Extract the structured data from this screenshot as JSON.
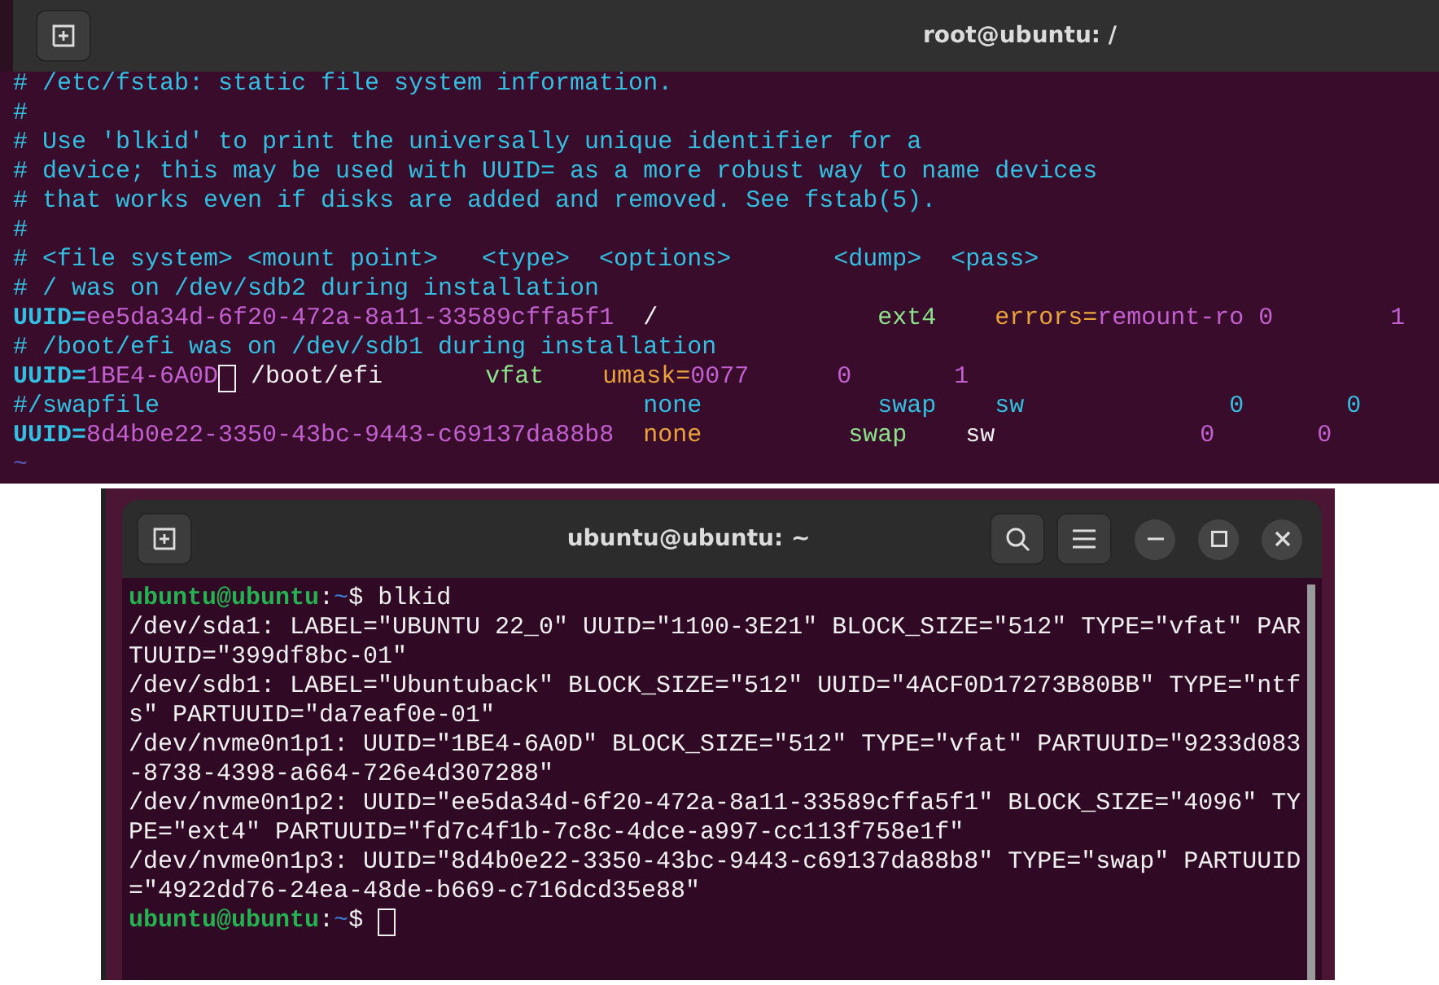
{
  "editor_window": {
    "title": "root@ubuntu: /",
    "lines": [
      [
        {
          "kind": "comment",
          "text": "# /etc/fstab: static file system information."
        }
      ],
      [
        {
          "kind": "comment",
          "text": "#"
        }
      ],
      [
        {
          "kind": "comment",
          "text": "# Use 'blkid' to print the universally unique identifier for a"
        }
      ],
      [
        {
          "kind": "comment",
          "text": "# device; this may be used with UUID= as a more robust way to name devices"
        }
      ],
      [
        {
          "kind": "comment",
          "text": "# that works even if disks are added and removed. See fstab(5)."
        }
      ],
      [
        {
          "kind": "comment",
          "text": "#"
        }
      ],
      [
        {
          "kind": "comment",
          "text": "# <file system> <mount point>   <type>  <options>       <dump>  <pass>"
        }
      ],
      [
        {
          "kind": "comment",
          "text": "# / was on /dev/sdb2 during installation"
        }
      ],
      [
        {
          "kind": "key",
          "text": "UUID="
        },
        {
          "kind": "value",
          "text": "ee5da34d-6f20-472a-8a11-33589cffa5f1"
        },
        {
          "kind": "plain",
          "text": "  /               "
        },
        {
          "kind": "type",
          "text": "ext4    "
        },
        {
          "kind": "option",
          "text": "errors="
        },
        {
          "kind": "value",
          "text": "remount-ro 0        1"
        }
      ],
      [
        {
          "kind": "comment",
          "text": "# /boot/efi was on /dev/sdb1 during installation"
        }
      ],
      [
        {
          "kind": "key",
          "text": "UUID="
        },
        {
          "kind": "value",
          "text": "1BE4-6A0D"
        },
        {
          "kind": "cursor"
        },
        {
          "kind": "plain",
          "text": " /boot/efi       "
        },
        {
          "kind": "type",
          "text": "vfat    "
        },
        {
          "kind": "option",
          "text": "umask="
        },
        {
          "kind": "value",
          "text": "0077      0       1"
        }
      ],
      [
        {
          "kind": "comment",
          "text": "#/swapfile                                 none            swap    sw              0       0"
        }
      ],
      [
        {
          "kind": "key",
          "text": "UUID="
        },
        {
          "kind": "value",
          "text": "8d4b0e22-3350-43bc-9443-c69137da88b8  "
        },
        {
          "kind": "option",
          "text": "none          "
        },
        {
          "kind": "type",
          "text": "swap"
        },
        {
          "kind": "plain",
          "text": "    sw              "
        },
        {
          "kind": "value",
          "text": "0       0"
        }
      ]
    ],
    "end_marker": "~"
  },
  "terminal_window": {
    "title": "ubuntu@ubuntu: ~",
    "lines": [
      [
        {
          "kind": "user",
          "text": "ubuntu@ubuntu"
        },
        {
          "kind": "plain",
          "text": ":"
        },
        {
          "kind": "path",
          "text": "~"
        },
        {
          "kind": "plain",
          "text": "$ blkid"
        }
      ],
      [
        {
          "kind": "plain",
          "text": "/dev/sda1: LABEL=\"UBUNTU 22_0\" UUID=\"1100-3E21\" BLOCK_SIZE=\"512\" TYPE=\"vfat\" PAR"
        }
      ],
      [
        {
          "kind": "plain",
          "text": "TUUID=\"399df8bc-01\""
        }
      ],
      [
        {
          "kind": "plain",
          "text": "/dev/sdb1: LABEL=\"Ubuntuback\" BLOCK_SIZE=\"512\" UUID=\"4ACF0D17273B80BB\" TYPE=\"ntf"
        }
      ],
      [
        {
          "kind": "plain",
          "text": "s\" PARTUUID=\"da7eaf0e-01\""
        }
      ],
      [
        {
          "kind": "plain",
          "text": "/dev/nvme0n1p1: UUID=\"1BE4-6A0D\" BLOCK_SIZE=\"512\" TYPE=\"vfat\" PARTUUID=\"9233d083"
        }
      ],
      [
        {
          "kind": "plain",
          "text": "-8738-4398-a664-726e4d307288\""
        }
      ],
      [
        {
          "kind": "plain",
          "text": "/dev/nvme0n1p2: UUID=\"ee5da34d-6f20-472a-8a11-33589cffa5f1\" BLOCK_SIZE=\"4096\" TY"
        }
      ],
      [
        {
          "kind": "plain",
          "text": "PE=\"ext4\" PARTUUID=\"fd7c4f1b-7c8c-4dce-a997-cc113f758e1f\""
        }
      ],
      [
        {
          "kind": "plain",
          "text": "/dev/nvme0n1p3: UUID=\"8d4b0e22-3350-43bc-9443-c69137da88b8\" TYPE=\"swap\" PARTUUID"
        }
      ],
      [
        {
          "kind": "plain",
          "text": "=\"4922dd76-24ea-48de-b669-c716dcd35e88\""
        }
      ],
      [
        {
          "kind": "user",
          "text": "ubuntu@ubuntu"
        },
        {
          "kind": "plain",
          "text": ":"
        },
        {
          "kind": "path",
          "text": "~"
        },
        {
          "kind": "plain",
          "text": "$ "
        },
        {
          "kind": "cursor"
        }
      ]
    ]
  }
}
